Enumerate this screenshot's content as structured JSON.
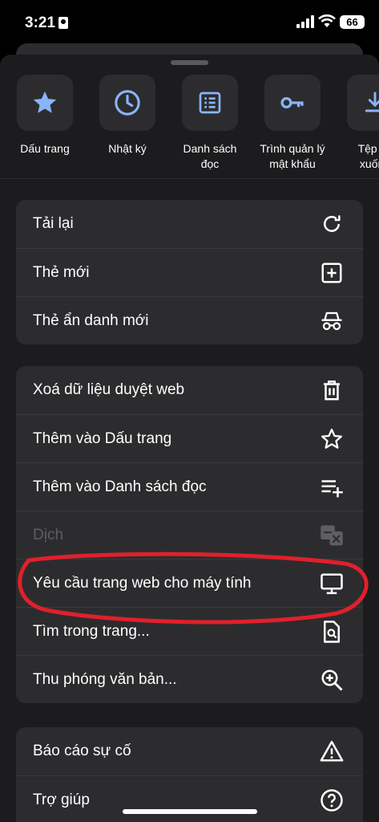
{
  "status_bar": {
    "time": "3:21",
    "battery": "66"
  },
  "shortcuts": [
    {
      "label": "Dấu trang",
      "icon": "star-icon"
    },
    {
      "label": "Nhật ký",
      "icon": "clock-icon"
    },
    {
      "label": "Danh sách đọc",
      "icon": "reading-list-icon"
    },
    {
      "label": "Trình quản lý mật khẩu",
      "icon": "key-icon"
    },
    {
      "label": "Tệp tải xuống",
      "icon": "download-icon"
    }
  ],
  "menu": {
    "group1": [
      {
        "label": "Tải lại",
        "icon": "reload-icon"
      },
      {
        "label": "Thẻ mới",
        "icon": "new-tab-icon"
      },
      {
        "label": "Thẻ ẩn danh mới",
        "icon": "incognito-icon"
      }
    ],
    "group2": [
      {
        "label": "Xoá dữ liệu duyệt web",
        "icon": "trash-icon"
      },
      {
        "label": "Thêm vào Dấu trang",
        "icon": "star-outline-icon"
      },
      {
        "label": "Thêm vào Danh sách đọc",
        "icon": "add-to-list-icon"
      },
      {
        "label": "Dịch",
        "icon": "translate-icon",
        "disabled": true
      },
      {
        "label": "Yêu cầu trang web cho máy tính",
        "icon": "desktop-icon"
      },
      {
        "label": "Tìm trong trang...",
        "icon": "find-in-page-icon"
      },
      {
        "label": "Thu phóng văn bản...",
        "icon": "zoom-in-icon"
      }
    ],
    "group3": [
      {
        "label": "Báo cáo sự cố",
        "icon": "warning-icon"
      },
      {
        "label": "Trợ giúp",
        "icon": "help-icon"
      }
    ]
  },
  "colors": {
    "accent": "#8ab4f8",
    "sheet": "#1c1c1e",
    "tile": "#2c2c2e",
    "annotation": "#e0202b"
  }
}
